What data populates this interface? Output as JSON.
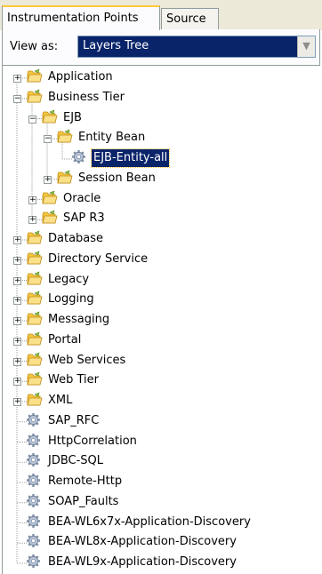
{
  "tabs": [
    {
      "label": "Instrumentation Points",
      "active": true
    },
    {
      "label": "Source",
      "active": false
    }
  ],
  "view_as": {
    "label": "View as:",
    "value": "Layers Tree"
  },
  "tree": {
    "items": [
      {
        "label": "Application",
        "type": "folder",
        "state": "collapsed"
      },
      {
        "label": "Business Tier",
        "type": "folder",
        "state": "expanded"
      },
      {
        "label": "EJB",
        "type": "folder",
        "state": "expanded"
      },
      {
        "label": "Entity Bean",
        "type": "folder",
        "state": "expanded"
      },
      {
        "label": "EJB-Entity-all",
        "type": "point",
        "selected": true
      },
      {
        "label": "Session Bean",
        "type": "folder",
        "state": "collapsed"
      },
      {
        "label": "Oracle",
        "type": "folder",
        "state": "collapsed"
      },
      {
        "label": "SAP R3",
        "type": "folder",
        "state": "collapsed"
      },
      {
        "label": "Database",
        "type": "folder",
        "state": "collapsed"
      },
      {
        "label": "Directory Service",
        "type": "folder",
        "state": "collapsed"
      },
      {
        "label": "Legacy",
        "type": "folder",
        "state": "collapsed"
      },
      {
        "label": "Logging",
        "type": "folder",
        "state": "collapsed"
      },
      {
        "label": "Messaging",
        "type": "folder",
        "state": "collapsed"
      },
      {
        "label": "Portal",
        "type": "folder",
        "state": "collapsed"
      },
      {
        "label": "Web Services",
        "type": "folder",
        "state": "collapsed"
      },
      {
        "label": "Web Tier",
        "type": "folder",
        "state": "collapsed"
      },
      {
        "label": "XML",
        "type": "folder",
        "state": "collapsed"
      },
      {
        "label": "SAP_RFC",
        "type": "point"
      },
      {
        "label": "HttpCorrelation",
        "type": "point"
      },
      {
        "label": "JDBC-SQL",
        "type": "point"
      },
      {
        "label": "Remote-Http",
        "type": "point"
      },
      {
        "label": "SOAP_Faults",
        "type": "point"
      },
      {
        "label": "BEA-WL6x7x-Application-Discovery",
        "type": "point"
      },
      {
        "label": "BEA-WL8x-Application-Discovery",
        "type": "point"
      },
      {
        "label": "BEA-WL9x-Application-Discovery",
        "type": "point"
      }
    ]
  },
  "colors": {
    "selection": "#0a246a",
    "tab_highlight": "#ffc83c",
    "folder": "#f5c842"
  },
  "icons": {
    "folder": "folder-icon",
    "point": "gear-icon",
    "expand": "plus-icon",
    "collapse": "minus-icon"
  }
}
